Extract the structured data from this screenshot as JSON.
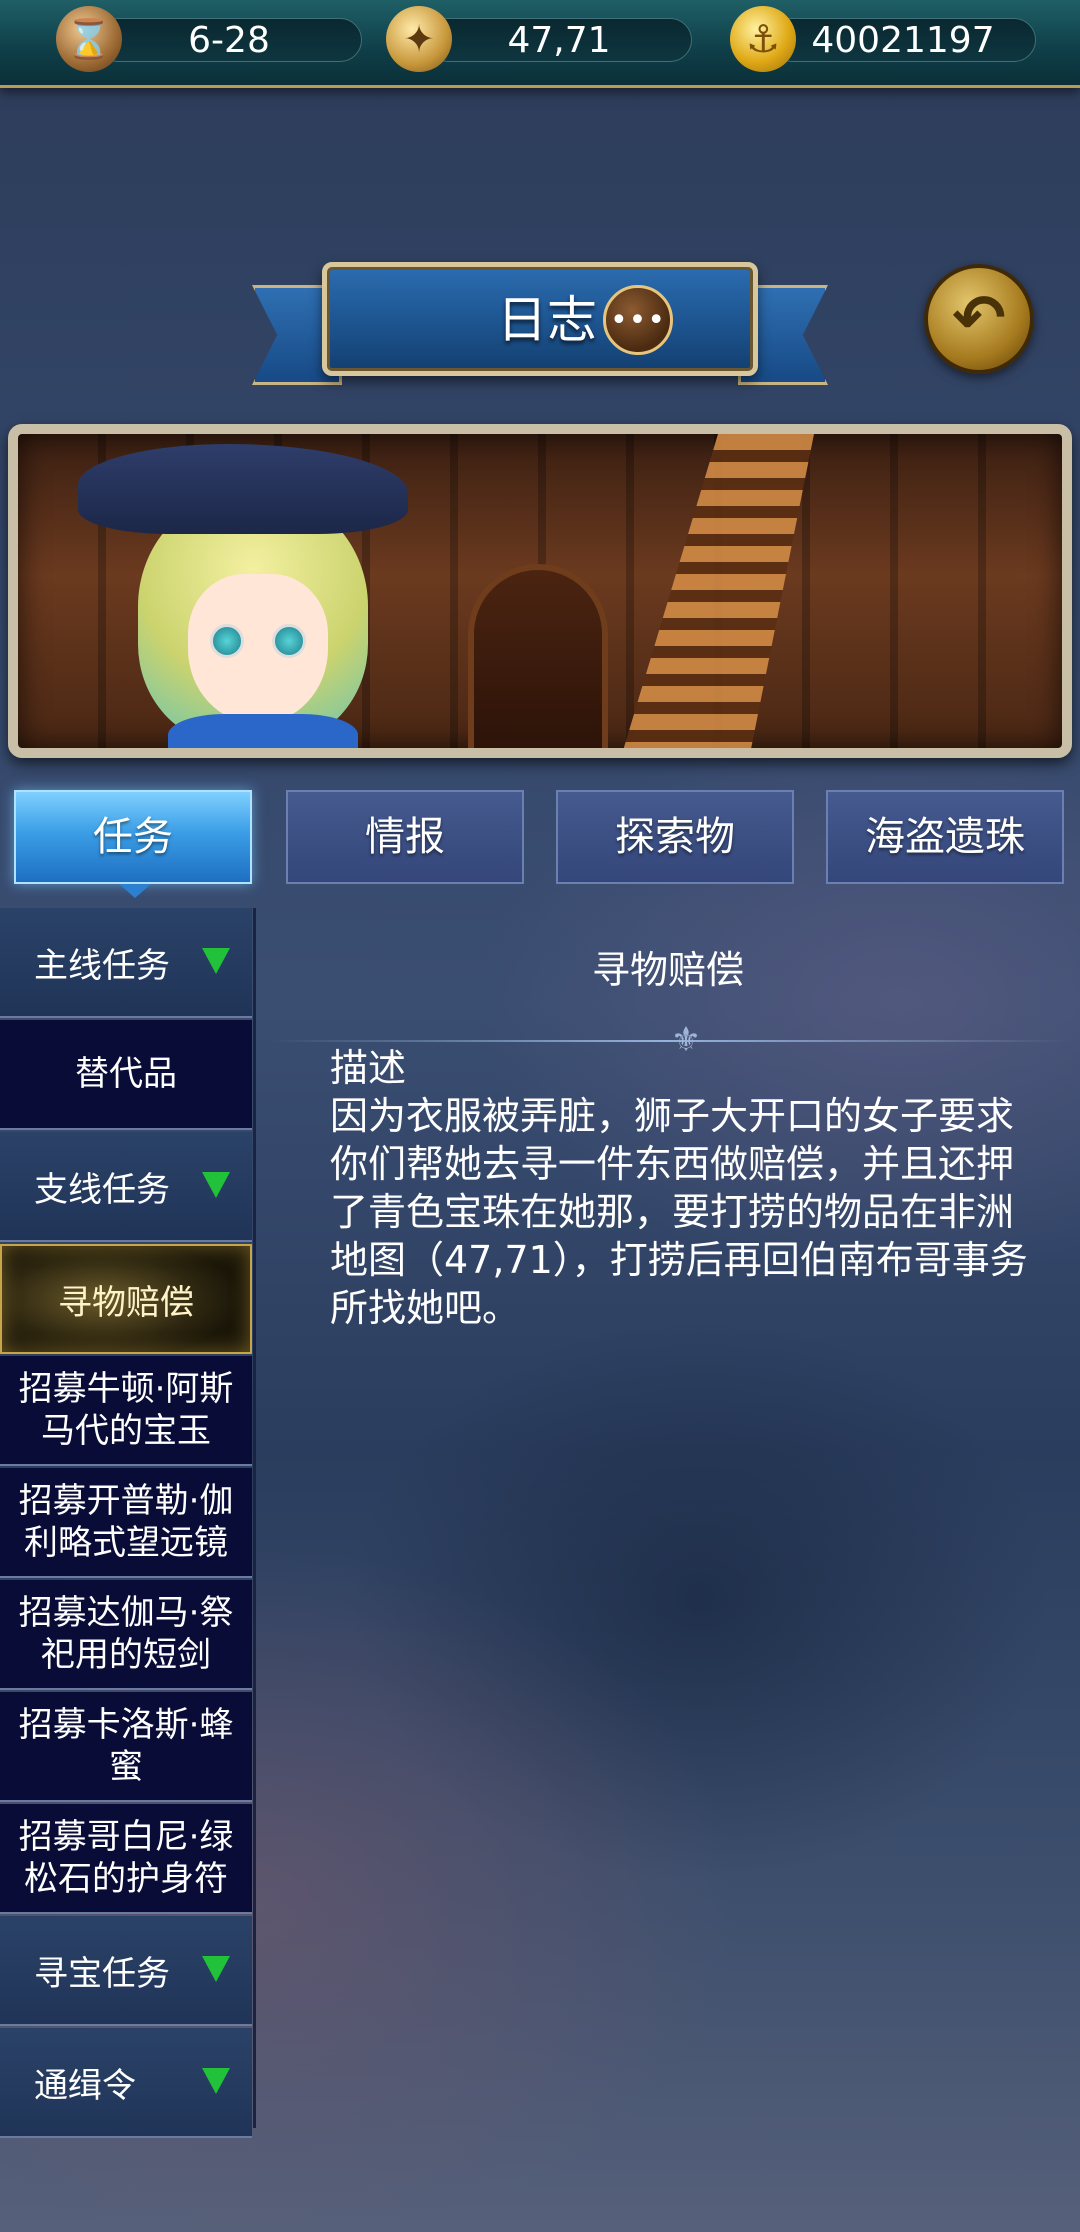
{
  "resources": {
    "date": {
      "icon": "hourglass-icon",
      "value": "6-28"
    },
    "coords": {
      "icon": "compass-icon",
      "value": "47,71"
    },
    "gold": {
      "icon": "gold-coin-icon",
      "value": "40021197"
    }
  },
  "header": {
    "title": "日志",
    "chat_icon_glyph": "•••",
    "back_icon_glyph": "↶"
  },
  "tabs": [
    {
      "label": "任务",
      "active": true
    },
    {
      "label": "情报",
      "active": false
    },
    {
      "label": "探索物",
      "active": false
    },
    {
      "label": "海盗遗珠",
      "active": false
    }
  ],
  "sidebar": {
    "items": [
      {
        "label": "主线任务",
        "type": "category"
      },
      {
        "label": "替代品",
        "type": "entry"
      },
      {
        "label": "支线任务",
        "type": "category"
      },
      {
        "label": "寻物赔偿",
        "type": "entry",
        "selected": true
      },
      {
        "label": "招募牛顿·阿斯马代的宝玉",
        "type": "entry"
      },
      {
        "label": "招募开普勒·伽利略式望远镜",
        "type": "entry"
      },
      {
        "label": "招募达伽马·祭祀用的短剑",
        "type": "entry"
      },
      {
        "label": "招募卡洛斯·蜂蜜",
        "type": "entry"
      },
      {
        "label": "招募哥白尼·绿松石的护身符",
        "type": "entry"
      },
      {
        "label": "寻宝任务",
        "type": "category"
      },
      {
        "label": "通缉令",
        "type": "category"
      }
    ]
  },
  "detail": {
    "title": "寻物赔偿",
    "description_label": "描述",
    "description": "因为衣服被弄脏，狮子大开口的女子要求你们帮她去寻一件东西做赔偿，并且还押了青色宝珠在她那，要打捞的物品在非洲地图（47,71），打捞后再回伯南布哥事务所找她吧。"
  },
  "colors": {
    "active_tab": "#3b9ee6",
    "category_arrow": "#22c13a",
    "selected_gold": "#c9a54a"
  }
}
